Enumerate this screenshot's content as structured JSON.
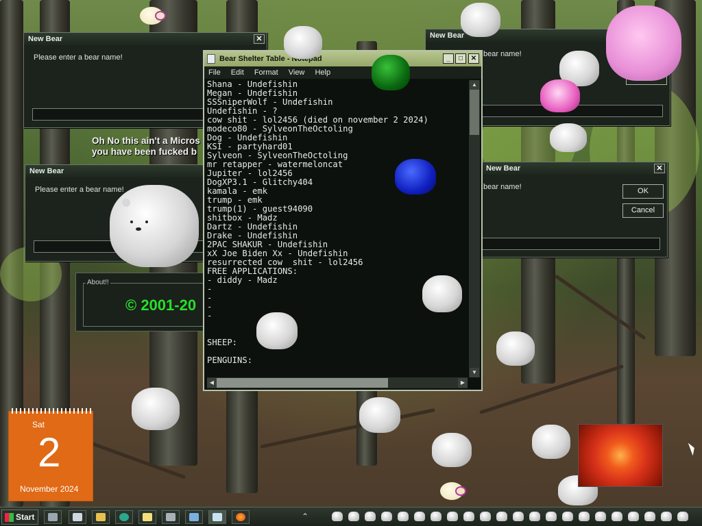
{
  "dialogs": {
    "new_bear_1": {
      "title": "New Bear",
      "close": "✕",
      "prompt": "Please enter a bear name!"
    },
    "new_bear_2": {
      "title": "New Bear",
      "close": "✕",
      "prompt": "Please enter a bear name!"
    },
    "new_bear_3": {
      "title": "New Bear",
      "close": "✕",
      "prompt": "bear name!",
      "ok": "OK",
      "cancel": "Cancel"
    },
    "new_bear_4": {
      "title": "New Bear",
      "close": "✕",
      "prompt": "bear name!",
      "ok": "OK",
      "cancel": "Cancel"
    }
  },
  "warning_text": {
    "line1": "Oh No this ain't a Micros",
    "line2": "you have been fucked b"
  },
  "about": {
    "label": "About!!",
    "copyright": "© 2001-20"
  },
  "notepad": {
    "title": "Bear Shelter Table - Notepad",
    "controls": {
      "minimize": "_",
      "maximize": "□",
      "close": "✕"
    },
    "menu": [
      "File",
      "Edit",
      "Format",
      "View",
      "Help"
    ],
    "lines": [
      "Shana - Undefishin",
      "Megan - Undefishin",
      "SSSniperWolf - Undefishin",
      "Undefishin - ?",
      "cow shit - lol2456 (died on november 2 2024)",
      "modeco80 - SylveonTheOctoling",
      "Dog - Undefishin",
      "KSI - partyhard01",
      "Sylveon - SylveonTheOctoling",
      "mr retapper - watermeloncat",
      "Jupiter - lol2456",
      "DogXP3.1 - Glitchy404",
      "kamala - emk",
      "trump - emk",
      "trump(1) - guest94090",
      "shitbox - Madz",
      "Dartz - Undefishin",
      "Drake - Undefishin",
      "2PAC SHAKUR - Undefishin",
      "xX Joe Biden Xx - Undefishin",
      "resurrected cow  shit - lol2456",
      "FREE APPLICATIONS:",
      "- diddy - Madz",
      "-",
      "-",
      "-",
      "-",
      "",
      "",
      "SHEEP:",
      "",
      "PENGUINS:"
    ]
  },
  "calendar": {
    "day": "Sat",
    "date": "2",
    "month": "November 2024"
  },
  "taskbar": {
    "start_label": "Start",
    "buttons": [
      "show-desktop",
      "window",
      "explorer",
      "edge",
      "notepad",
      "calculator",
      "paint",
      "notepad-active",
      "firefox"
    ],
    "tray_expand": "⌃"
  },
  "colors": {
    "accent_green": "#27e02a",
    "notepad_title": "#a8b87e",
    "calendar": "#e06a16"
  }
}
